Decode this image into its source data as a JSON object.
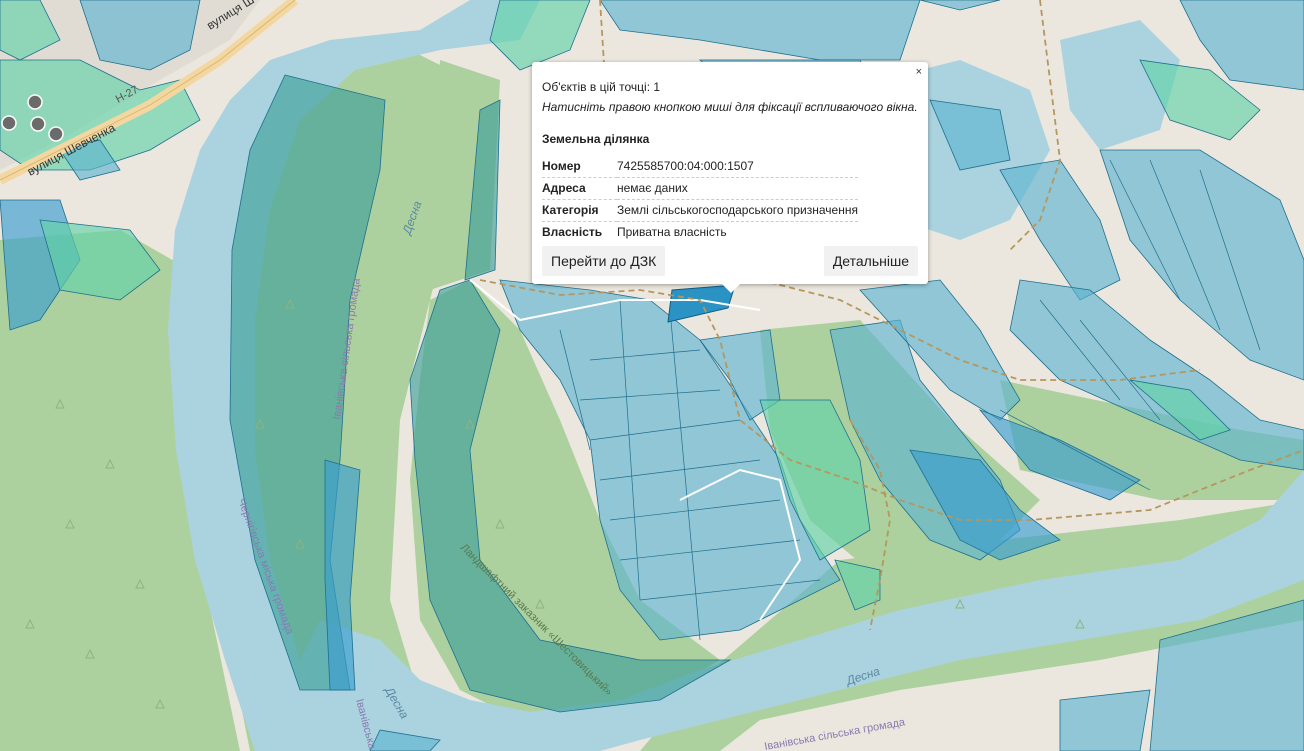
{
  "map": {
    "labels": {
      "road_h27": "H-27",
      "street_shevchenka": "вулиця Шевченка",
      "street_top": "вулиця Ш",
      "river_desna": "Десна",
      "hromada_ivanivska": "Іванівська сільська громада",
      "hromada_chernihivska": "Чернігівська міська громада",
      "reserve": "Ландшафтний заказник «Шестовицький»",
      "ivanivska_short": "Іванівська"
    },
    "colors": {
      "land": "#ebe7df",
      "forest": "#add19e",
      "water": "#aad3df",
      "parcel": "#5fb3cf",
      "parcel_green": "#62d3a8",
      "parcel_selected": "#2a93c4"
    }
  },
  "popup": {
    "close_label": "×",
    "objects_count": "Об'єктів в цій точці: 1",
    "hint": "Натисніть правою кнопкою миші для фіксації вспливаючого вікна.",
    "title": "Земельна ділянка",
    "rows": [
      {
        "key": "Номер",
        "value": "7425585700:04:000:1507"
      },
      {
        "key": "Адреса",
        "value": "немає даних"
      },
      {
        "key": "Категорія",
        "value": "Землі сільськогосподарського призначення"
      },
      {
        "key": "Власність",
        "value": "Приватна власність"
      }
    ],
    "btn_dzk": "Перейти до ДЗК",
    "btn_details": "Детальніше"
  }
}
